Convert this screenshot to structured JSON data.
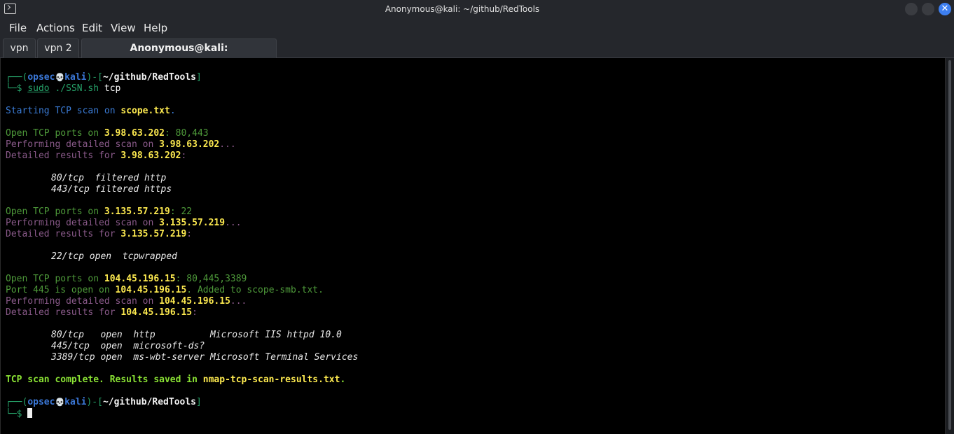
{
  "window": {
    "title": "Anonymous@kali: ~/github/RedTools",
    "icon": "terminal-icon"
  },
  "menu": [
    "File",
    "Actions",
    "Edit",
    "View",
    "Help"
  ],
  "tabs": [
    {
      "label": "vpn",
      "active": false
    },
    {
      "label": "vpn 2",
      "active": false
    },
    {
      "label": "Anonymous@kali: ~/github/RedTools",
      "active": true
    }
  ],
  "prompt": {
    "frame_top": "┌──(",
    "user": "opsec",
    "skull": "💀",
    "host": "kali",
    "sep": ")-[",
    "path": "~/github/RedTools",
    "close": "]",
    "frame_bottom": "└─$ ",
    "first_command_sudo": "sudo",
    "first_command_rest": " ./SSN.sh",
    "first_command_arg": " tcp"
  },
  "output": {
    "start": {
      "text": "Starting TCP scan on ",
      "file": "scope.txt",
      "end": "."
    },
    "hosts": [
      {
        "open_label": "Open TCP ports on ",
        "ip": "3.98.63.202",
        "ports": ": 80,443",
        "detail_label": "Performing detailed scan on ",
        "ellipsis": "...",
        "results_label": "Detailed results for ",
        "colon": ":",
        "rows": [
          "80/tcp  filtered http",
          "443/tcp filtered https"
        ]
      },
      {
        "open_label": "Open TCP ports on ",
        "ip": "3.135.57.219",
        "ports": ": 22",
        "detail_label": "Performing detailed scan on ",
        "ellipsis": "...",
        "results_label": "Detailed results for ",
        "colon": ":",
        "rows": [
          "22/tcp open  tcpwrapped"
        ]
      },
      {
        "open_label": "Open TCP ports on ",
        "ip": "104.45.196.15",
        "ports": ": 80,445,3389",
        "smb_label": "Port 445 is open on ",
        "smb_end": ". Added to scope-smb.txt.",
        "detail_label": "Performing detailed scan on ",
        "ellipsis": "...",
        "results_label": "Detailed results for ",
        "colon": ":",
        "rows": [
          "80/tcp   open  http          Microsoft IIS httpd 10.0",
          "445/tcp  open  microsoft-ds?",
          "3389/tcp open  ms-wbt-server Microsoft Terminal Services"
        ]
      }
    ],
    "complete": {
      "text": "TCP scan complete. Results saved in ",
      "file": "nmap-tcp-scan-results.txt",
      "end": "."
    }
  }
}
